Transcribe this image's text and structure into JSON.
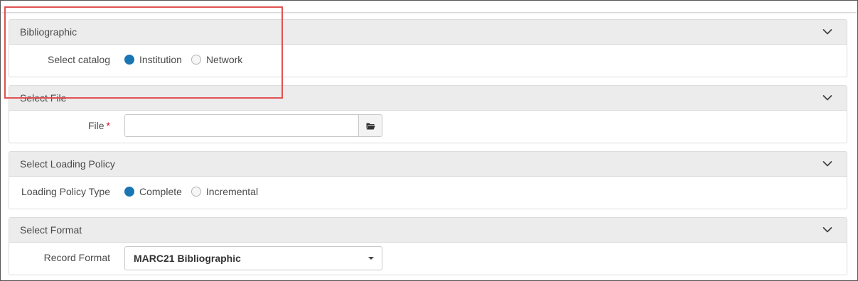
{
  "sections": [
    {
      "title": "Bibliographic",
      "field_label": "Select catalog",
      "options": [
        {
          "label": "Institution",
          "checked": true
        },
        {
          "label": "Network",
          "checked": false
        }
      ]
    },
    {
      "title": "Select File",
      "field_label": "File",
      "required_mark": "*",
      "input_value": ""
    },
    {
      "title": "Select Loading Policy",
      "field_label": "Loading Policy Type",
      "options": [
        {
          "label": "Complete",
          "checked": true
        },
        {
          "label": "Incremental",
          "checked": false
        }
      ]
    },
    {
      "title": "Select Format",
      "field_label": "Record Format",
      "selected_value": "MARC21 Bibliographic"
    }
  ],
  "icons": {
    "collapse": "chevron-down-icon",
    "browse": "folder-icon",
    "dropdown": "caret-down-icon"
  },
  "colors": {
    "accent": "#1a75b3",
    "required": "#d0021b",
    "highlight": "#e05252",
    "header_bg": "#ececec"
  }
}
